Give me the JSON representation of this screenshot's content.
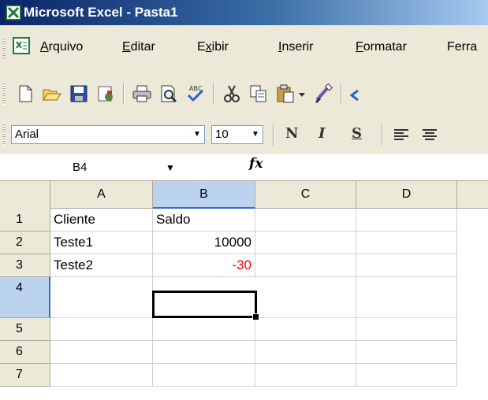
{
  "window": {
    "title": "Microsoft Excel - Pasta1"
  },
  "menu": [
    {
      "label": "Arquivo",
      "pre": "",
      "u": "A",
      "post": "rquivo"
    },
    {
      "label": "Editar",
      "pre": "",
      "u": "E",
      "post": "ditar"
    },
    {
      "label": "Exibir",
      "pre": "E",
      "u": "x",
      "post": "ibir"
    },
    {
      "label": "Inserir",
      "pre": "",
      "u": "I",
      "post": "nserir"
    },
    {
      "label": "Formatar",
      "pre": "",
      "u": "F",
      "post": "ormatar"
    },
    {
      "label": "Ferra",
      "pre": "Ferra",
      "u": "",
      "post": ""
    }
  ],
  "toolbar": {
    "icons": [
      "new-icon",
      "open-icon",
      "save-icon",
      "permission-icon",
      "print-icon",
      "print-preview-icon",
      "spelling-icon",
      "cut-icon",
      "copy-icon",
      "paste-icon",
      "dropdown-arrow-icon",
      "format-painter-icon",
      "undo-icon"
    ]
  },
  "format_toolbar": {
    "font": "Arial",
    "size": "10",
    "bold": "N",
    "italic": "I",
    "underline": "S"
  },
  "formula_bar": {
    "name_box": "B4",
    "fx": "fx",
    "content": ""
  },
  "columns": [
    "A",
    "B",
    "C",
    "D"
  ],
  "rows": [
    {
      "num": "1",
      "a": "Cliente",
      "b": "Saldo"
    },
    {
      "num": "2",
      "a": "Teste1",
      "b": "10000"
    },
    {
      "num": "3",
      "a": "Teste2",
      "b": "-30"
    },
    {
      "num": "4",
      "a": "",
      "b": ""
    },
    {
      "num": "5",
      "a": "",
      "b": ""
    },
    {
      "num": "6",
      "a": "",
      "b": ""
    },
    {
      "num": "7",
      "a": "",
      "b": ""
    }
  ],
  "colors": {
    "negative": "#ff0000",
    "selection_header": "#bcd3ef",
    "title_start": "#0a246a"
  }
}
